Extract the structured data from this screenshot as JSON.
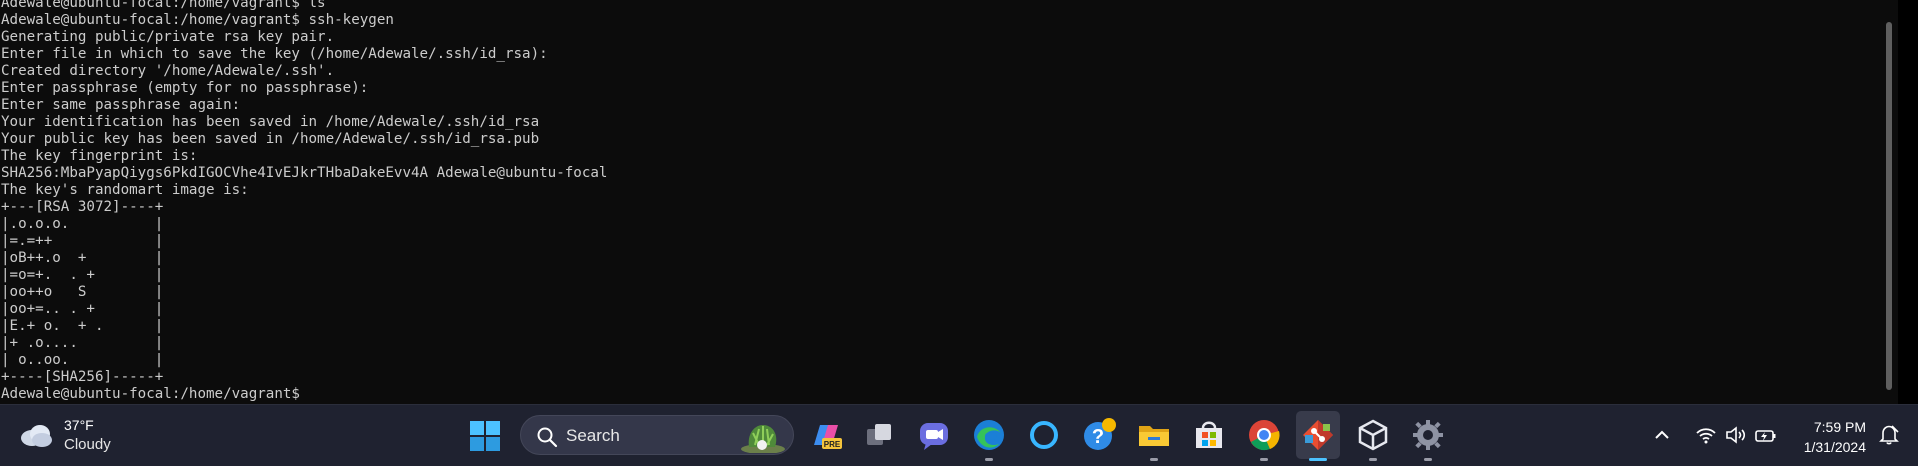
{
  "terminal": {
    "lines": [
      "Adewale@ubuntu-focal:/home/vagrant$ ls",
      "Adewale@ubuntu-focal:/home/vagrant$ ssh-keygen",
      "Generating public/private rsa key pair.",
      "Enter file in which to save the key (/home/Adewale/.ssh/id_rsa):",
      "Created directory '/home/Adewale/.ssh'.",
      "Enter passphrase (empty for no passphrase):",
      "Enter same passphrase again:",
      "Your identification has been saved in /home/Adewale/.ssh/id_rsa",
      "Your public key has been saved in /home/Adewale/.ssh/id_rsa.pub",
      "The key fingerprint is:",
      "SHA256:MbaPyapQiygs6PkdIGOCVhe4IvEJkrTHbaDakeEvv4A Adewale@ubuntu-focal",
      "The key's randomart image is:",
      "+---[RSA 3072]----+",
      "|.o.o.o.          |",
      "|=.=++            |",
      "|oB++.o  +        |",
      "|=o=+.  . +       |",
      "|oo++o   S        |",
      "|oo+=.. . +       |",
      "|E.+ o.  + .      |",
      "|+ .o....         |",
      "| o..oo.          |",
      "+----[SHA256]-----+",
      "Adewale@ubuntu-focal:/home/vagrant$ "
    ]
  },
  "taskbar": {
    "weather": {
      "temp": "37°F",
      "condition": "Cloudy"
    },
    "search": {
      "label": "Search"
    },
    "apps": [
      "start-icon",
      "copilot-pre-icon",
      "task-view-icon",
      "teams-chat-icon",
      "edge-icon",
      "cortana-ring-icon",
      "get-help-icon",
      "file-explorer-icon",
      "microsoft-store-icon",
      "chrome-icon",
      "git-icon",
      "virtualbox-icon",
      "settings-icon"
    ],
    "tray": {
      "time": "7:59 PM",
      "date": "1/31/2024"
    }
  },
  "colors": {
    "terminal_bg": "#0c0c0c",
    "terminal_fg": "#cccccc",
    "taskbar_bg": "#1f2230",
    "accent": "#4cc2ff"
  }
}
